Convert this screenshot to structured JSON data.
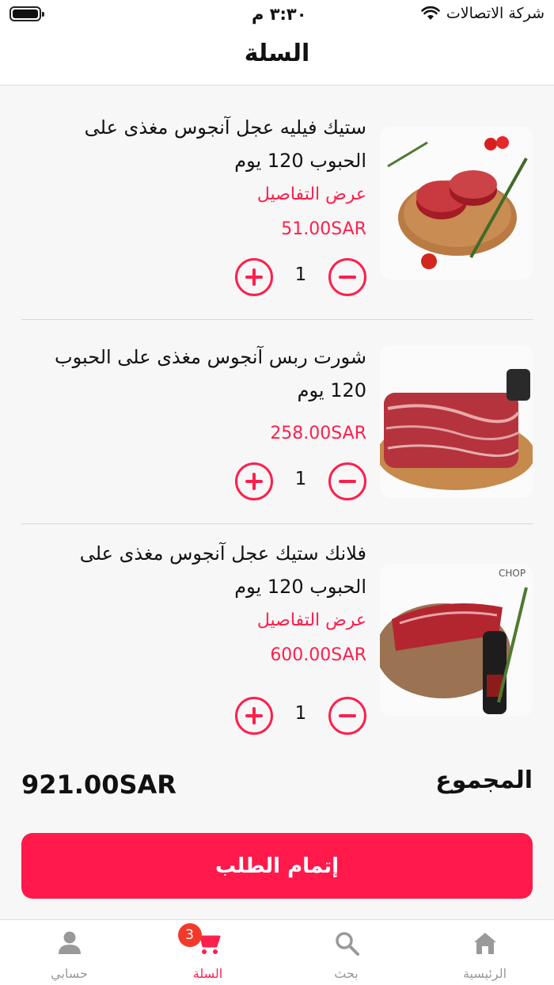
{
  "status_bar": {
    "time": "٣:٣٠ م",
    "carrier": "شركة الاتصالات"
  },
  "header": {
    "title": "السلة"
  },
  "cart": {
    "items": [
      {
        "name": "ستيك فيليه عجل آنجوس مغذى على الحبوب 120 يوم",
        "details_link": "عرض التفاصيل",
        "price": "51.00SAR",
        "quantity": "1"
      },
      {
        "name": "شورت ربس آنجوس مغذى على الحبوب 120 يوم",
        "price": "258.00SAR",
        "quantity": "1"
      },
      {
        "name": "فلانك ستيك عجل آنجوس مغذى على الحبوب 120 يوم",
        "details_link": "عرض التفاصيل",
        "price": "600.00SAR",
        "quantity": "1"
      }
    ]
  },
  "summary": {
    "total_label": "المجموع",
    "total_value": "921.00SAR"
  },
  "checkout": {
    "label": "إتمام الطلب"
  },
  "tab_bar": {
    "tabs": [
      {
        "label": "الرئيسية",
        "icon": "home-icon"
      },
      {
        "label": "بحث",
        "icon": "search-icon"
      },
      {
        "label": "السلة",
        "icon": "cart-icon",
        "badge": "3",
        "active": true
      },
      {
        "label": "حسابي",
        "icon": "user-icon"
      }
    ]
  },
  "colors": {
    "accent": "#ff1f4c",
    "badge": "#f23a2b",
    "inactive": "#999999"
  }
}
